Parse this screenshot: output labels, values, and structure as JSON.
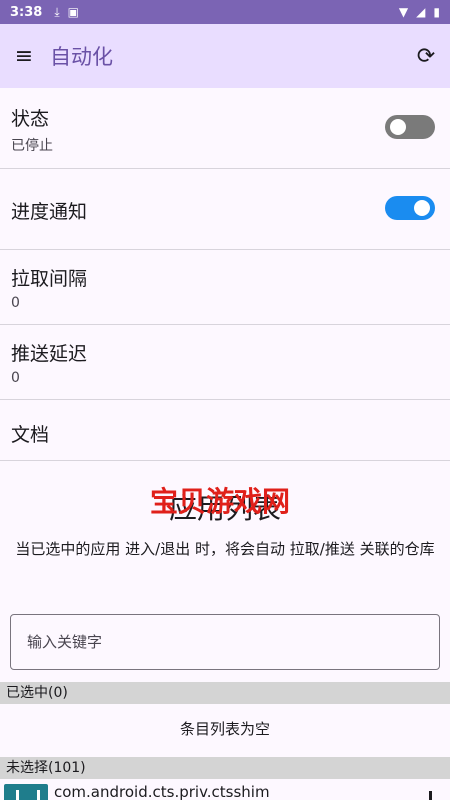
{
  "status_bar": {
    "time": "3:38"
  },
  "app_bar": {
    "title": "自动化"
  },
  "prefs": {
    "status": {
      "title": "状态",
      "subtitle": "已停止",
      "enabled": false
    },
    "progress": {
      "title": "进度通知",
      "enabled": true
    },
    "pull_interval": {
      "title": "拉取间隔",
      "value": "0"
    },
    "push_delay": {
      "title": "推送延迟",
      "value": "0"
    },
    "docs": {
      "title": "文档"
    }
  },
  "app_list": {
    "title": "应用列表",
    "watermark": "宝贝游戏网",
    "description": "当已选中的应用 进入/退出 时，将会自动 拉取/推送 关联的仓库",
    "search_placeholder": "输入关键字",
    "selected_header": "已选中(0)",
    "empty_text": "条目列表为空",
    "unselected_header": "未选择(101)",
    "items": [
      {
        "name": "com.android.cts.priv.ctsshim"
      }
    ]
  },
  "colors": {
    "status_bar": "#7b64b4",
    "app_bar": "#e9ddff",
    "title": "#6a51a6",
    "switch_on": "#1a8cf0",
    "switch_off": "#7a7a7a"
  }
}
